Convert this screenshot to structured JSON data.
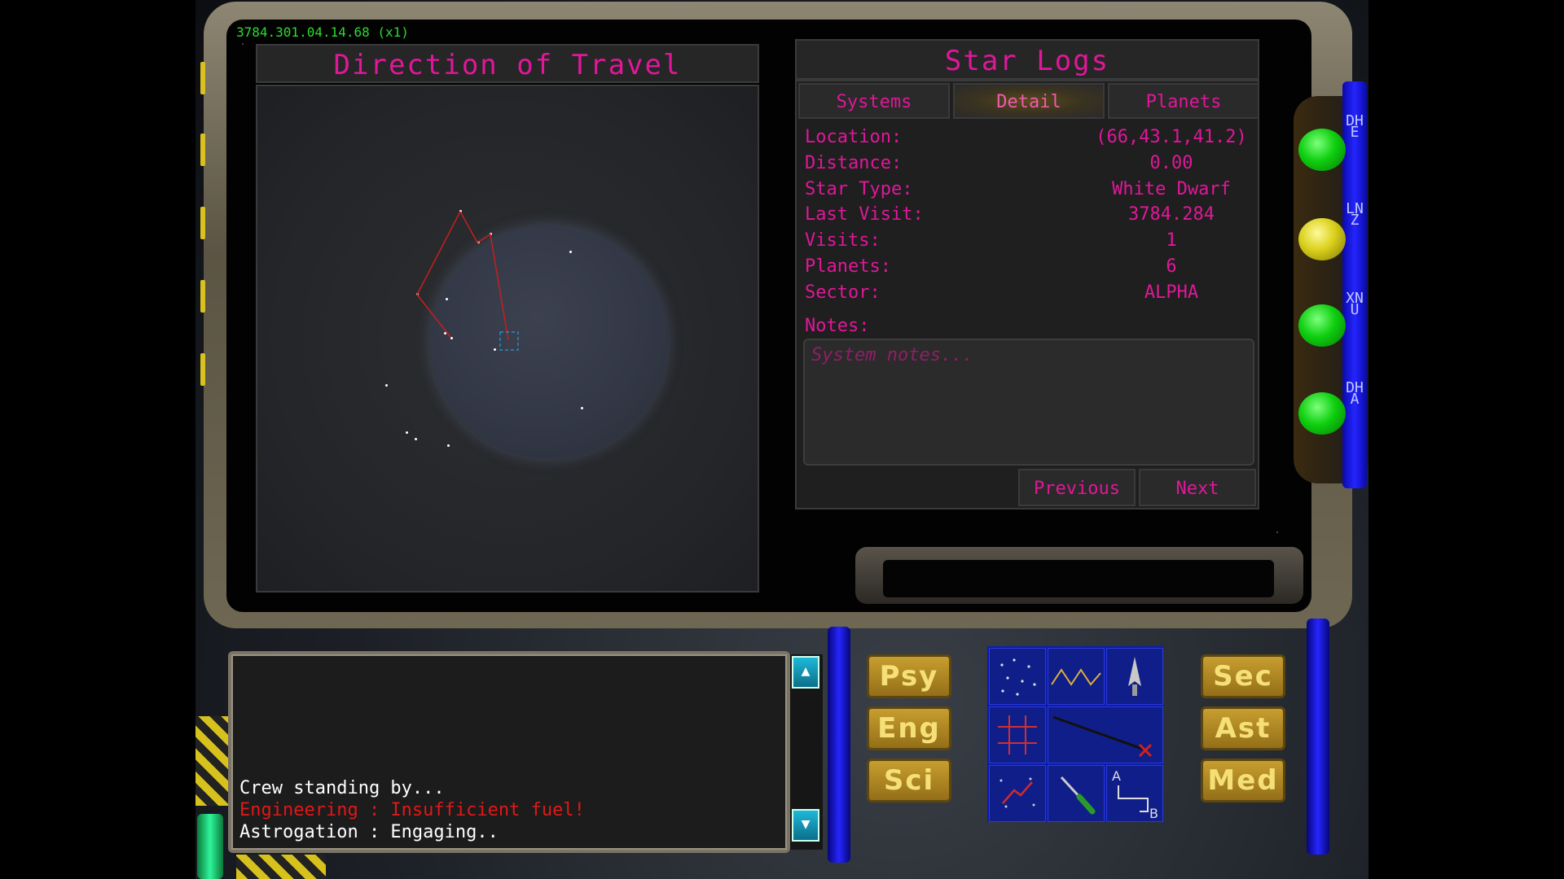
{
  "stamp": "3784.301.04.14.68 (x1)",
  "direction_panel": {
    "title": "Direction of Travel"
  },
  "star_logs": {
    "title": "Star Logs",
    "tabs": [
      "Systems",
      "Detail",
      "Planets"
    ],
    "selected_tab": "Detail",
    "rows": [
      {
        "label": "Location:",
        "value": "(66,43.1,41.2)"
      },
      {
        "label": "Distance:",
        "value": "0.00"
      },
      {
        "label": "Star Type:",
        "value": "White Dwarf"
      },
      {
        "label": "Last Visit:",
        "value": "3784.284"
      },
      {
        "label": "Visits:",
        "value": "1"
      },
      {
        "label": "Planets:",
        "value": "6"
      },
      {
        "label": "Sector:",
        "value": "ALPHA"
      }
    ],
    "notes_label": "Notes:",
    "notes_placeholder": "System notes...",
    "previous_label": "Previous",
    "next_label": "Next"
  },
  "status_lights": [
    "green",
    "yellow",
    "green",
    "green"
  ],
  "messages": [
    {
      "text": "Crew standing by...",
      "color": "#ffffff"
    },
    {
      "text": "Engineering : Insufficient fuel!",
      "color": "#e01818"
    },
    {
      "text": "Astrogation : Engaging..",
      "color": "#ffffff"
    }
  ],
  "officers_left": [
    "Psy",
    "Eng",
    "Sci"
  ],
  "officers_right": [
    "Sec",
    "Ast",
    "Med"
  ],
  "tools": [
    "starfield-icon",
    "wave-icon",
    "ship-icon",
    "target-grid-icon",
    "course-line-icon",
    "scan-icon",
    "repair-icon",
    "ab-route-icon"
  ],
  "tool_letters": {
    "a": "A",
    "b": "B"
  },
  "rail_glyphs": [
    "DHE",
    "LNZ",
    "XNU",
    "DHA"
  ],
  "colors": {
    "accent": "#e0179a",
    "panel": "#1f1f1f",
    "console_green": "#2bdc2b",
    "officer_gold": "#c79e2f",
    "tool_blue": "#0b1bb0"
  }
}
